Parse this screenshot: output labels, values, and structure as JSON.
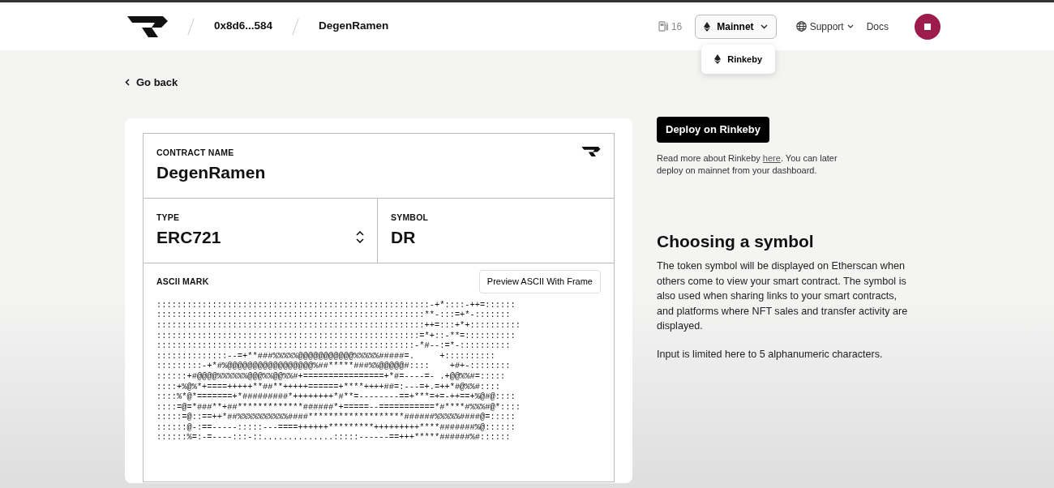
{
  "header": {
    "address": "0x8d6...584",
    "project": "DegenRamen",
    "gas": "16",
    "network": {
      "label": "Mainnet",
      "expanded": true,
      "options": [
        {
          "label": "Rinkeby"
        }
      ]
    },
    "support": "Support",
    "docs": "Docs"
  },
  "back": "Go back",
  "contract": {
    "name_label": "CONTRACT NAME",
    "name": "DegenRamen",
    "type_label": "TYPE",
    "type": "ERC721",
    "symbol_label": "SYMBOL",
    "symbol": "DR",
    "ascii_label": "ASCII MARK",
    "preview_button": "Preview ASCII With Frame",
    "ascii_lines": [
      "::::::::::::::::::::::::::::::::::::::::::::::::::::::-+*::::-++=::::::",
      ":::::::::::::::::::::::::::::::::::::::::::::::::::::**-:::=+*-:::::::",
      ":::::::::::::::::::::::::::::::::::::::::::::::::::::++=:::+*+::::::::::",
      "::::::::::::::::::::::::::::::::::::::::::::::::::::=*+::-**=::::::::::",
      ":::::::::::::::::::::::::::::::::::::::::::::::::::-*#--:=*-::::::::::",
      "::::::::::::::--=+**###%%%%%@@@@@@@@@@@%%%%%#####=.     +::::::::::",
      ":::::::::-+*#%@@@@@@@@@@@@@@@@@%##*****###%%@@@@@#::::    +#+-::::::::",
      "::::::+#@@@@%%%%%%@@@%%@@%%#+================+*#=----=- .+@@%%#=:::::",
      "::::+%@%*+====+++++**##**+++++======+****++++##=:---=+.=++*#@%%#::::",
      "::::%*@*=======+*#########*++++++++*#**=--------==+***=+=-++==+%@#@::::",
      "::::=@=*###**+##*************######*+=====--===========*#****#%%%#@*::::",
      ":::::=@::==++*##%%%%%%%%%%####*******************######%%%%%####@=:::::",
      "::::::@-:==-----:::::---====++++++*********+++++++++****#######%@::::::",
      "::::::%=:-=----:::-::..............:::::------==+++*****######%#::::::"
    ]
  },
  "sidebar": {
    "deploy_button": "Deploy on Rinkeby",
    "note_before": "Read more about Rinkeby ",
    "note_link": "here",
    "note_after": ". You can later deploy on mainnet from your dashboard.",
    "heading": "Choosing a symbol",
    "paragraphs": [
      "The token symbol will be displayed on Etherscan when others come to view your smart contract. The symbol is also used when sharing links to your smart contracts, and platforms where NFT sales and transfer activity are displayed.",
      "Input is limited here to 5 alphanumeric characters."
    ]
  }
}
